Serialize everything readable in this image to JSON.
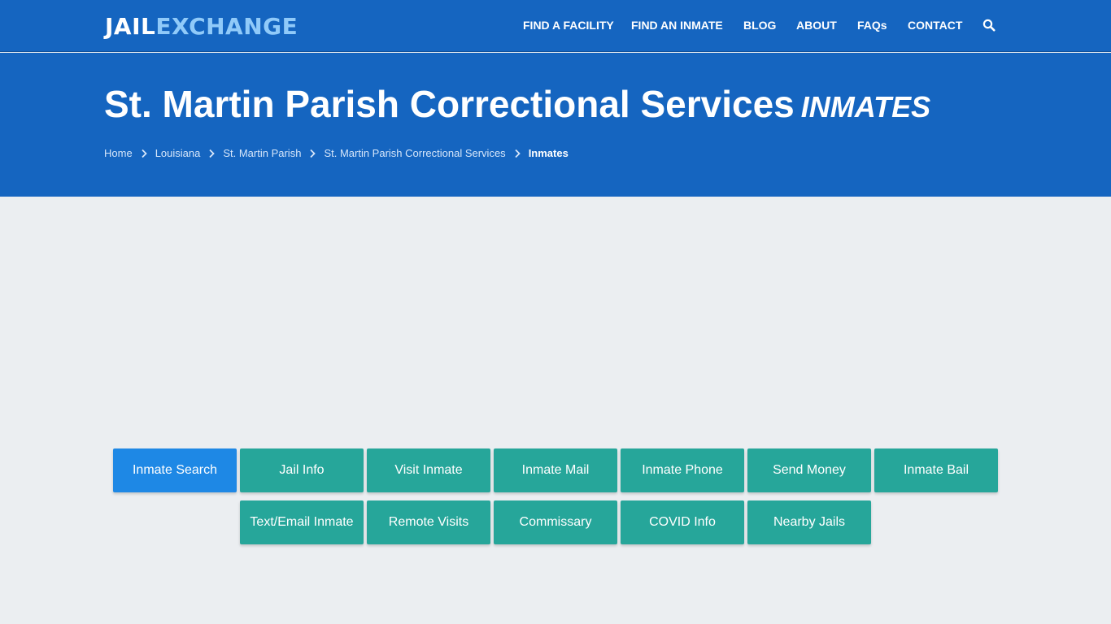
{
  "logo": {
    "part1": "JAIL",
    "part2": "EXCHANGE"
  },
  "nav": {
    "items": [
      "FIND A FACILITY",
      "FIND AN INMATE",
      "BLOG",
      "ABOUT",
      "FAQs",
      "CONTACT"
    ],
    "search_icon": "search-icon"
  },
  "hero": {
    "title": "St. Martin Parish Correctional Services",
    "subtitle": "INMATES"
  },
  "breadcrumb": [
    "Home",
    "Louisiana",
    "St. Martin Parish",
    "St. Martin Parish Correctional Services",
    "Inmates"
  ],
  "buttons": {
    "row1": [
      "Inmate Search",
      "Jail Info",
      "Visit Inmate",
      "Inmate Mail",
      "Inmate Phone",
      "Send Money",
      "Inmate Bail"
    ],
    "row2": [
      "Text/Email Inmate",
      "Remote Visits",
      "Commissary",
      "COVID Info",
      "Nearby Jails"
    ]
  },
  "colors": {
    "header": "#1565c0",
    "button": "#26a69a",
    "button_active": "#1e88e5",
    "background": "#ebeef1"
  }
}
